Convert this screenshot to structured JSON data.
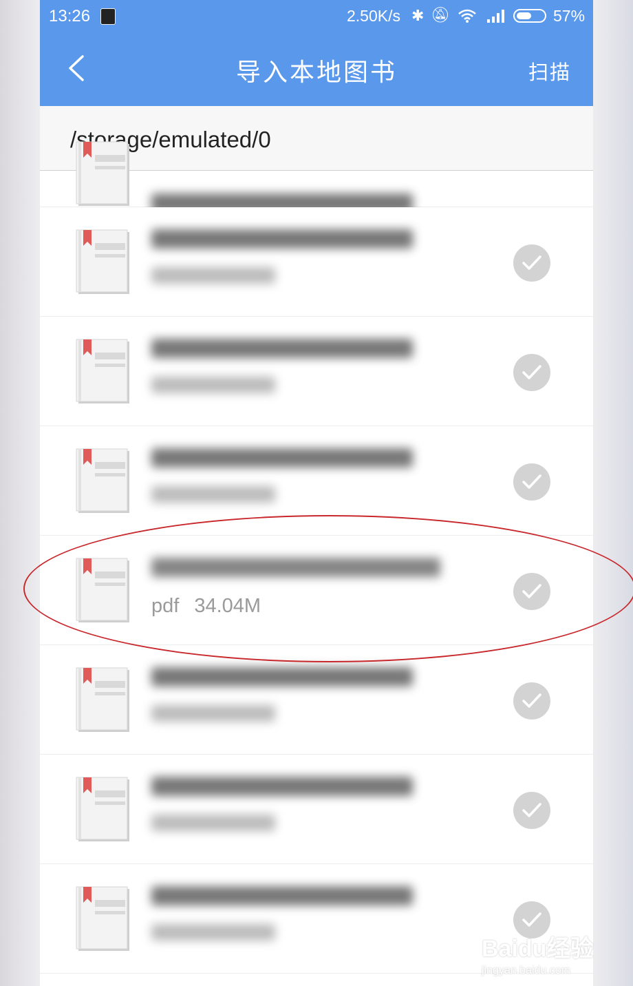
{
  "status_bar": {
    "time": "13:26",
    "net_speed": "2.50K/s",
    "battery_percent": "57%",
    "battery_level": 0.57
  },
  "app_bar": {
    "title": "导入本地图书",
    "scan_label": "扫描"
  },
  "path": "/storage/emulated/0",
  "files": [
    {
      "title": "",
      "type": "",
      "size": "",
      "blurred": true
    },
    {
      "title": "",
      "type": "",
      "size": "",
      "blurred": true
    },
    {
      "title": "",
      "type": "",
      "size": "",
      "blurred": true
    },
    {
      "title": "",
      "type": "",
      "size": "",
      "blurred": true
    },
    {
      "title": "",
      "type": "pdf",
      "size": "34.04M",
      "blurred": false
    },
    {
      "title": "",
      "type": "",
      "size": "",
      "blurred": true
    },
    {
      "title": "",
      "type": "",
      "size": "",
      "blurred": true
    },
    {
      "title": "",
      "type": "",
      "size": "",
      "blurred": true
    }
  ],
  "watermark": {
    "brand": "Baidu经验",
    "url": "jingyan.baidu.com"
  },
  "colors": {
    "header": "#5a98ec",
    "check": "#d3d3d3",
    "highlight": "#c8272b"
  }
}
